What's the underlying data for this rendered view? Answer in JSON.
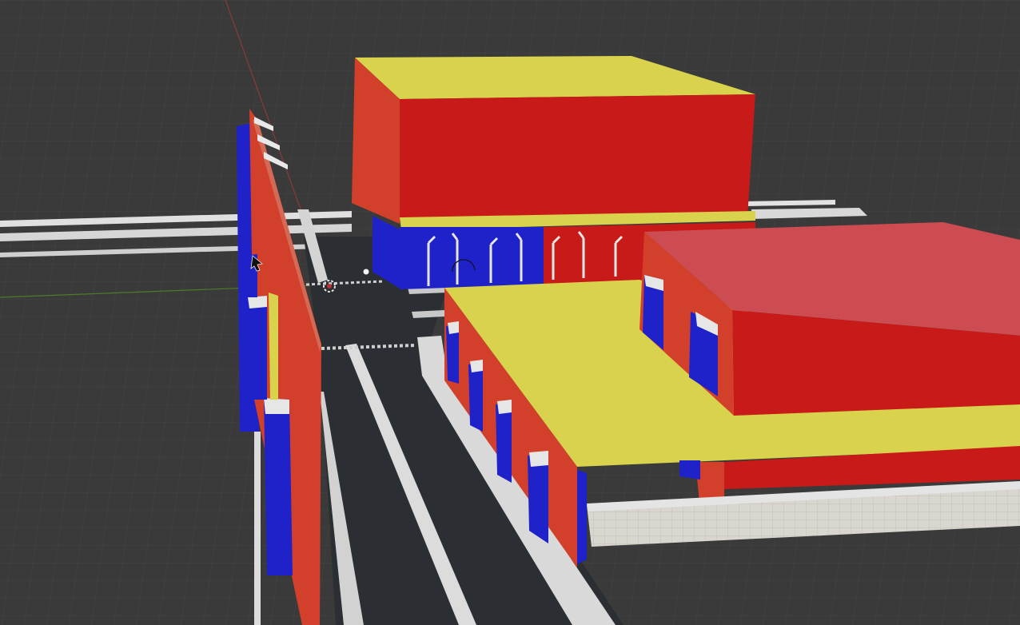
{
  "viewport": {
    "kind": "3d-viewport",
    "colors": {
      "background": "#3a3a3a",
      "grid_minor": "#444444",
      "grid_major": "#4c4c4c",
      "x_axis": "#8a3a3a",
      "y_axis": "#4f7a2a",
      "road": "#2b2f33",
      "sidewalk": "#dcdcdc",
      "roof_yellow": "#d8d24c",
      "wall_red": "#c81a18",
      "wall_orange": "#d2402c",
      "door_blue": "#1f22c8",
      "floor_grid": "#d8d6ce"
    }
  },
  "overlays": {
    "origin_marker": "origin-marker-icon",
    "light_object": "light-icon",
    "cursor": "mouse-cursor-icon"
  }
}
